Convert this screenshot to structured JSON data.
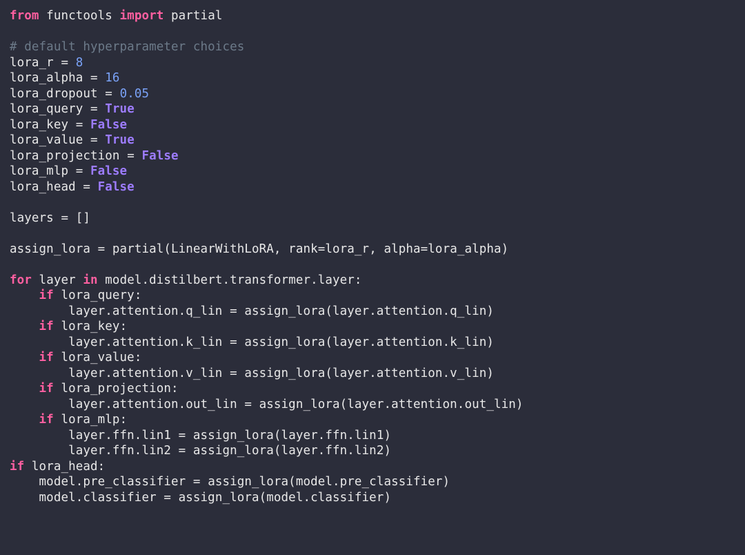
{
  "code": {
    "language": "python",
    "tokens": [
      [
        [
          "kw",
          "from"
        ],
        [
          "def",
          " functools "
        ],
        [
          "kw",
          "import"
        ],
        [
          "def",
          " partial"
        ]
      ],
      [],
      [
        [
          "cmt",
          "# default hyperparameter choices"
        ]
      ],
      [
        [
          "def",
          "lora_r "
        ],
        [
          "op",
          "= "
        ],
        [
          "num",
          "8"
        ]
      ],
      [
        [
          "def",
          "lora_alpha "
        ],
        [
          "op",
          "= "
        ],
        [
          "num",
          "16"
        ]
      ],
      [
        [
          "def",
          "lora_dropout "
        ],
        [
          "op",
          "= "
        ],
        [
          "num",
          "0.05"
        ]
      ],
      [
        [
          "def",
          "lora_query "
        ],
        [
          "op",
          "= "
        ],
        [
          "bool",
          "True"
        ]
      ],
      [
        [
          "def",
          "lora_key "
        ],
        [
          "op",
          "= "
        ],
        [
          "bool",
          "False"
        ]
      ],
      [
        [
          "def",
          "lora_value "
        ],
        [
          "op",
          "= "
        ],
        [
          "bool",
          "True"
        ]
      ],
      [
        [
          "def",
          "lora_projection "
        ],
        [
          "op",
          "= "
        ],
        [
          "bool",
          "False"
        ]
      ],
      [
        [
          "def",
          "lora_mlp "
        ],
        [
          "op",
          "= "
        ],
        [
          "bool",
          "False"
        ]
      ],
      [
        [
          "def",
          "lora_head "
        ],
        [
          "op",
          "= "
        ],
        [
          "bool",
          "False"
        ]
      ],
      [],
      [
        [
          "def",
          "layers "
        ],
        [
          "op",
          "= []"
        ]
      ],
      [],
      [
        [
          "def",
          "assign_lora "
        ],
        [
          "op",
          "= "
        ],
        [
          "def",
          "partial(LinearWithLoRA, rank"
        ],
        [
          "op",
          "="
        ],
        [
          "def",
          "lora_r, alpha"
        ],
        [
          "op",
          "="
        ],
        [
          "def",
          "lora_alpha)"
        ]
      ],
      [],
      [
        [
          "kw",
          "for"
        ],
        [
          "def",
          " layer "
        ],
        [
          "kw",
          "in"
        ],
        [
          "def",
          " model.distilbert.transformer.layer"
        ],
        [
          "op",
          ":"
        ]
      ],
      [
        [
          "def",
          "    "
        ],
        [
          "kw",
          "if"
        ],
        [
          "def",
          " lora_query"
        ],
        [
          "op",
          ":"
        ]
      ],
      [
        [
          "def",
          "        layer.attention.q_lin "
        ],
        [
          "op",
          "= "
        ],
        [
          "def",
          "assign_lora(layer.attention.q_lin)"
        ]
      ],
      [
        [
          "def",
          "    "
        ],
        [
          "kw",
          "if"
        ],
        [
          "def",
          " lora_key"
        ],
        [
          "op",
          ":"
        ]
      ],
      [
        [
          "def",
          "        layer.attention.k_lin "
        ],
        [
          "op",
          "= "
        ],
        [
          "def",
          "assign_lora(layer.attention.k_lin)"
        ]
      ],
      [
        [
          "def",
          "    "
        ],
        [
          "kw",
          "if"
        ],
        [
          "def",
          " lora_value"
        ],
        [
          "op",
          ":"
        ]
      ],
      [
        [
          "def",
          "        layer.attention.v_lin "
        ],
        [
          "op",
          "= "
        ],
        [
          "def",
          "assign_lora(layer.attention.v_lin)"
        ]
      ],
      [
        [
          "def",
          "    "
        ],
        [
          "kw",
          "if"
        ],
        [
          "def",
          " lora_projection"
        ],
        [
          "op",
          ":"
        ]
      ],
      [
        [
          "def",
          "        layer.attention.out_lin "
        ],
        [
          "op",
          "= "
        ],
        [
          "def",
          "assign_lora(layer.attention.out_lin)"
        ]
      ],
      [
        [
          "def",
          "    "
        ],
        [
          "kw",
          "if"
        ],
        [
          "def",
          " lora_mlp"
        ],
        [
          "op",
          ":"
        ]
      ],
      [
        [
          "def",
          "        layer.ffn.lin1 "
        ],
        [
          "op",
          "= "
        ],
        [
          "def",
          "assign_lora(layer.ffn.lin1)"
        ]
      ],
      [
        [
          "def",
          "        layer.ffn.lin2 "
        ],
        [
          "op",
          "= "
        ],
        [
          "def",
          "assign_lora(layer.ffn.lin2)"
        ]
      ],
      [
        [
          "kw",
          "if"
        ],
        [
          "def",
          " lora_head"
        ],
        [
          "op",
          ":"
        ]
      ],
      [
        [
          "def",
          "    model.pre_classifier "
        ],
        [
          "op",
          "= "
        ],
        [
          "def",
          "assign_lora(model.pre_classifier)"
        ]
      ],
      [
        [
          "def",
          "    model.classifier "
        ],
        [
          "op",
          "= "
        ],
        [
          "def",
          "assign_lora(model.classifier)"
        ]
      ]
    ]
  }
}
